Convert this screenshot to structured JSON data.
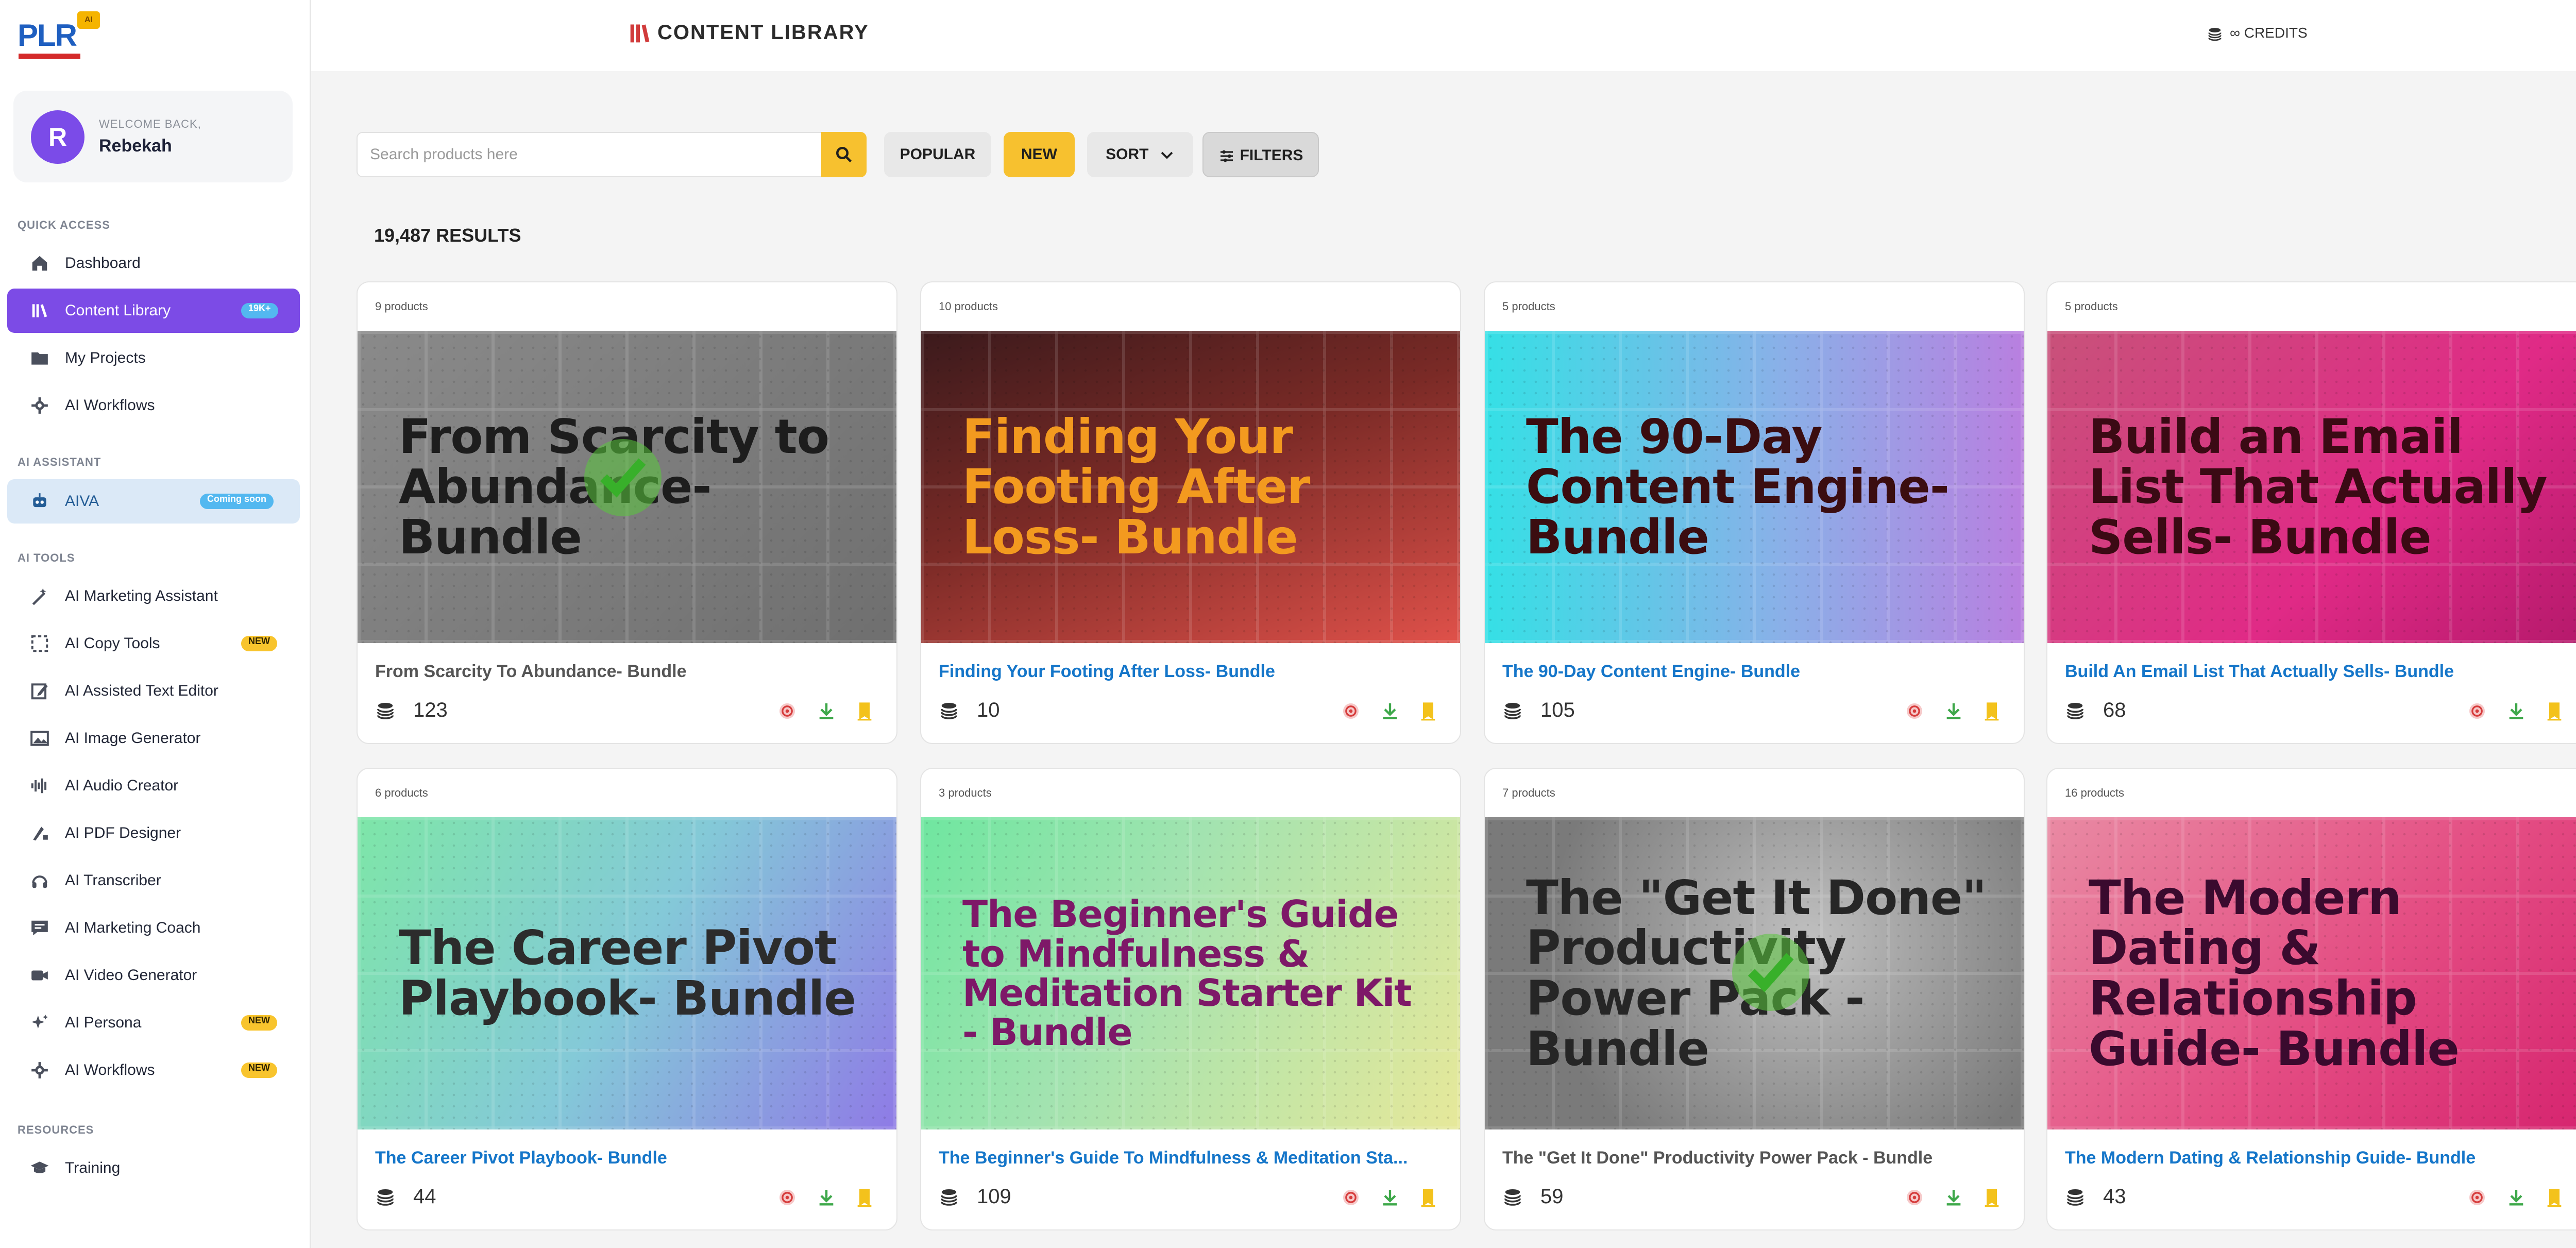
{
  "sidebar": {
    "logo_text": "PLR",
    "logo_badge": "AI",
    "user": {
      "initial": "R",
      "welcome": "WELCOME BACK,",
      "name": "Rebekah"
    },
    "sections": {
      "quick": "QUICK ACCESS",
      "assistant": "AI ASSISTANT",
      "tools": "AI TOOLS",
      "resources": "RESOURCES"
    },
    "quick_items": [
      {
        "label": "Dashboard"
      },
      {
        "label": "Content Library",
        "badge": "19K+"
      },
      {
        "label": "My Projects"
      },
      {
        "label": "AI Workflows"
      }
    ],
    "assistant_items": [
      {
        "label": "AIVA",
        "badge": "Coming soon"
      }
    ],
    "tool_items": [
      {
        "label": "AI Marketing Assistant"
      },
      {
        "label": "AI Copy Tools",
        "badge": "NEW"
      },
      {
        "label": "AI Assisted Text Editor"
      },
      {
        "label": "AI Image Generator"
      },
      {
        "label": "AI Audio Creator"
      },
      {
        "label": "AI PDF Designer"
      },
      {
        "label": "AI Transcriber"
      },
      {
        "label": "AI Marketing Coach"
      },
      {
        "label": "AI Video Generator"
      },
      {
        "label": "AI Persona",
        "badge": "NEW"
      },
      {
        "label": "AI Workflows",
        "badge": "NEW"
      }
    ],
    "resource_items": [
      {
        "label": "Training"
      }
    ]
  },
  "header": {
    "title": "CONTENT LIBRARY",
    "credits": "∞ CREDITS"
  },
  "toolbar": {
    "search_placeholder": "Search products here",
    "search_value": "",
    "popular": "POPULAR",
    "new": "NEW",
    "sort": "SORT",
    "filters": "FILTERS"
  },
  "results": "19,487 RESULTS",
  "colors": {
    "accent_purple": "#7c4be6",
    "accent_yellow": "#f7c12f",
    "link_blue": "#1576c9"
  },
  "cards": [
    {
      "count": "9 products",
      "headline": "From Scarcity to Abundance- Bundle",
      "title": "From Scarcity To Abundance- Bundle",
      "credits": "123",
      "downloaded": true
    },
    {
      "count": "10 products",
      "headline": "Finding Your Footing After Loss- Bundle",
      "title": "Finding Your Footing After Loss- Bundle",
      "credits": "10",
      "downloaded": false
    },
    {
      "count": "5 products",
      "headline": "The 90-Day Content Engine- Bundle",
      "title": "The 90-Day Content Engine- Bundle",
      "credits": "105",
      "downloaded": false
    },
    {
      "count": "5 products",
      "headline": "Build an Email List That Actually Sells- Bundle",
      "title": "Build An Email List That Actually Sells- Bundle",
      "credits": "68",
      "downloaded": false
    },
    {
      "count": "6 products",
      "headline": "The Career Pivot Playbook- Bundle",
      "title": "The Career Pivot Playbook- Bundle",
      "credits": "44",
      "downloaded": false
    },
    {
      "count": "3 products",
      "headline": "The Beginner's Guide to Mindfulness & Meditation Starter Kit - Bundle",
      "title": "The Beginner's Guide To Mindfulness & Meditation Sta...",
      "credits": "109",
      "downloaded": false
    },
    {
      "count": "7 products",
      "headline": "The \"Get It Done\" Productivity Power Pack - Bundle",
      "title": "The \"Get It Done\" Productivity Power Pack - Bundle",
      "credits": "59",
      "downloaded": true
    },
    {
      "count": "16 products",
      "headline": "The Modern Dating & Relationship Guide- Bundle",
      "title": "The Modern Dating & Relationship Guide- Bundle",
      "credits": "43",
      "downloaded": false
    }
  ]
}
